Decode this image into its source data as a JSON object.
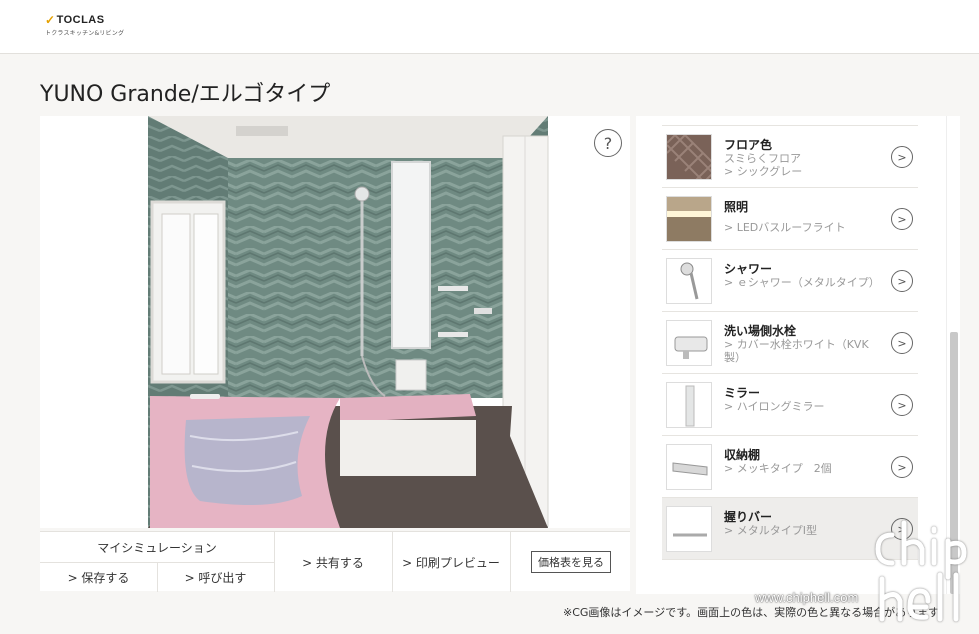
{
  "header": {
    "logo_main": "TOCLAS",
    "logo_sub": "トクラスキッチン&リビング"
  },
  "page_title": "YUNO Grande/エルゴタイプ",
  "viewer": {
    "help_label": "?"
  },
  "actions": {
    "my_simulation": "マイシミュレーション",
    "save": "> 保存する",
    "load": "> 呼び出す",
    "share": "> 共有する",
    "print_preview": "> 印刷プレビュー",
    "price_list": "価格表を見る"
  },
  "options": [
    {
      "title": "フロア色",
      "sub": [
        "スミらくフロア",
        "> シックグレー"
      ],
      "icon": "herringbone-floor-swatch",
      "selected": false
    },
    {
      "title": "照明",
      "sub": [
        "> LEDバスルーフライト"
      ],
      "icon": "led-light-thumb",
      "selected": false
    },
    {
      "title": "シャワー",
      "sub": [
        "> ｅシャワー（メタルタイプ）"
      ],
      "icon": "shower-head-thumb",
      "selected": false
    },
    {
      "title": "洗い場側水栓",
      "sub": [
        "> カバー水栓ホワイト（KVK",
        "製）"
      ],
      "icon": "faucet-thumb",
      "selected": false
    },
    {
      "title": "ミラー",
      "sub": [
        "> ハイロングミラー"
      ],
      "icon": "mirror-thumb",
      "selected": false
    },
    {
      "title": "収納棚",
      "sub": [
        "> メッキタイプ　2個"
      ],
      "icon": "shelf-thumb",
      "selected": false
    },
    {
      "title": "握りバー",
      "sub": [
        "> メタルタイプI型"
      ],
      "icon": "grab-bar-thumb",
      "selected": true
    }
  ],
  "chevron": ">",
  "disclaimer": "※CG画像はイメージです。画面上の色は、実際の色と異なる場合があります。",
  "watermark_url": "www.chiphell.com",
  "colors": {
    "wall_tile": "#6f8a82",
    "bathtub": "#e6b4c4",
    "floor": "#5a504c",
    "accent_logo": "#e5a100"
  }
}
